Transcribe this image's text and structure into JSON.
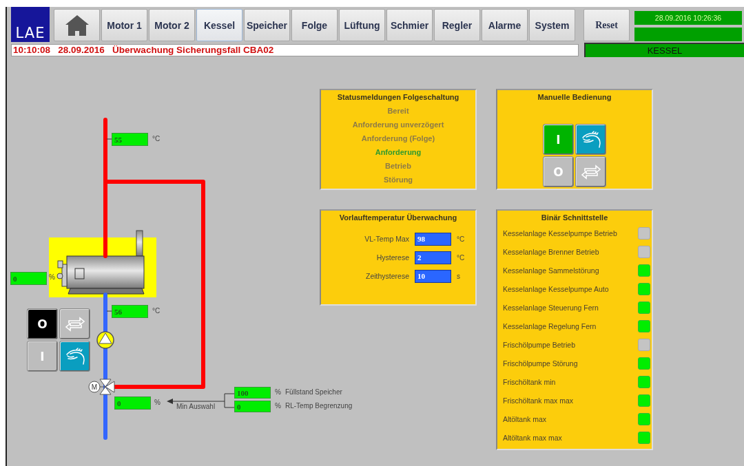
{
  "logo": {
    "text": "LAE"
  },
  "nav": [
    {
      "kind": "home",
      "selected": false
    },
    {
      "kind": "text",
      "label": "Motor 1",
      "selected": false
    },
    {
      "kind": "text",
      "label": "Motor 2",
      "selected": false
    },
    {
      "kind": "text",
      "label": "Kessel",
      "selected": true
    },
    {
      "kind": "text",
      "label": "Speicher",
      "selected": false
    },
    {
      "kind": "text",
      "label": "Folge",
      "selected": false
    },
    {
      "kind": "text",
      "label": "Lüftung",
      "selected": false
    },
    {
      "kind": "text",
      "label": "Schmier",
      "selected": false
    },
    {
      "kind": "text",
      "label": "Regler",
      "selected": false
    },
    {
      "kind": "text",
      "label": "Alarme",
      "selected": false
    },
    {
      "kind": "text",
      "label": "System",
      "selected": false
    }
  ],
  "reset_button": "Reset",
  "datetime": "28.09.2016 10:26:36",
  "message": "10:10:08   28.09.2016   Überwachung Sicherungsfall CBA02",
  "section": "KESSEL",
  "diagram": {
    "flow_temp": {
      "value": "55",
      "unit": "°C"
    },
    "burner": {
      "value": "0",
      "unit": "%"
    },
    "return_temp": {
      "value": "56",
      "unit": "°C"
    },
    "valve_motor": "M",
    "mixer_output": {
      "value": "0",
      "unit": "%"
    },
    "min_select_label": "Min Auswahl",
    "inputs": [
      {
        "value": "100",
        "unit": "%",
        "label": "Füllstand Speicher"
      },
      {
        "value": "0",
        "unit": "%",
        "label": "RL-Temp Begrenzung"
      }
    ],
    "controls": [
      {
        "kind": "off",
        "label": "O",
        "active": true
      },
      {
        "kind": "auto",
        "active": false
      },
      {
        "kind": "on",
        "label": "I",
        "active": false
      },
      {
        "kind": "manual",
        "active": true
      }
    ]
  },
  "status_panel": {
    "title": "Statusmeldungen Folgeschaltung",
    "items": [
      {
        "label": "Bereit",
        "active": false
      },
      {
        "label": "Anforderung unverzögert",
        "active": false
      },
      {
        "label": "Anforderung (Folge)",
        "active": false
      },
      {
        "label": "Anforderung",
        "active": true
      },
      {
        "label": "Betrieb",
        "active": false
      },
      {
        "label": "Störung",
        "active": false
      }
    ]
  },
  "manual_panel": {
    "title": "Manuelle Bedienung",
    "controls": [
      {
        "kind": "on",
        "label": "I",
        "active": true
      },
      {
        "kind": "manual",
        "active": true
      },
      {
        "kind": "off",
        "label": "O",
        "active": false
      },
      {
        "kind": "auto",
        "active": false
      }
    ]
  },
  "temp_panel": {
    "title": "Vorlauftemperatur Überwachung",
    "fields": [
      {
        "label": "VL-Temp Max",
        "value": "98",
        "unit": "°C"
      },
      {
        "label": "Hysterese",
        "value": "2",
        "unit": "°C"
      },
      {
        "label": "Zeithysterese",
        "value": "10",
        "unit": "s"
      }
    ]
  },
  "binary_panel": {
    "title": "Binär Schnittstelle",
    "items": [
      {
        "label": "Kesselanlage Kesselpumpe Betrieb",
        "on": false
      },
      {
        "label": "Kesselanlage Brenner Betrieb",
        "on": false
      },
      {
        "label": "Kesselanlage Sammelstörung",
        "on": true
      },
      {
        "label": "Kesselanlage Kesselpumpe Auto",
        "on": true
      },
      {
        "label": "Kesselanlage Steuerung Fern",
        "on": true
      },
      {
        "label": "Kesselanlage Regelung Fern",
        "on": true
      },
      {
        "label": "Frischölpumpe Betrieb",
        "on": false
      },
      {
        "label": "Frischölpumpe Störung",
        "on": true
      },
      {
        "label": "Frischöltank min",
        "on": true
      },
      {
        "label": "Frischöltank max max",
        "on": true
      },
      {
        "label": "Altöltank max",
        "on": true
      },
      {
        "label": "Altöltank max max",
        "on": true
      }
    ]
  }
}
